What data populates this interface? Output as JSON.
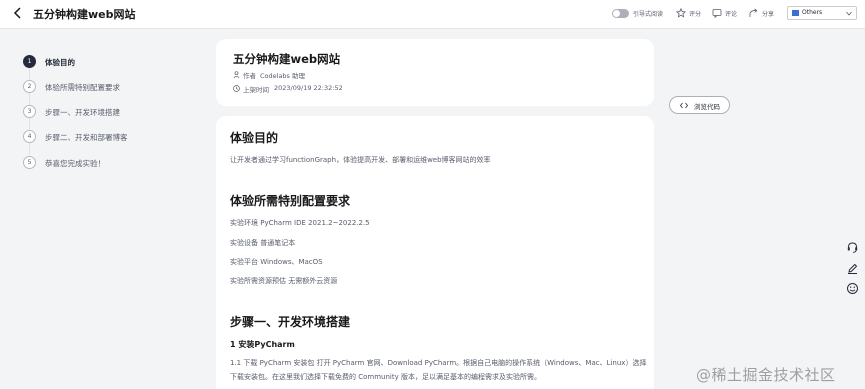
{
  "topbar": {
    "title": "五分钟构建web网站",
    "immersive_label": "引导式阅读",
    "rate_label": "评分",
    "comment_label": "评论",
    "share_label": "分享",
    "language_value": "Others"
  },
  "steps": [
    {
      "num": "1",
      "label": "体验目的",
      "active": true
    },
    {
      "num": "2",
      "label": "体验所需特别配置要求",
      "active": false
    },
    {
      "num": "3",
      "label": "步骤一、开发环境搭建",
      "active": false
    },
    {
      "num": "4",
      "label": "步骤二、开发和部署博客",
      "active": false
    },
    {
      "num": "5",
      "label": "恭喜您完成实验！",
      "active": false
    }
  ],
  "header": {
    "title": "五分钟构建web网站",
    "author_key": "作者",
    "author_value": "Codelabs 助理",
    "time_key": "上架时间",
    "time_value": "2023/09/19 22:32:52"
  },
  "view_code_label": "浏览代码",
  "content": {
    "s1_title": "体验目的",
    "s1_text": "让开发者通过学习functionGraph，体验提高开发、部署和运维web博客网站的效率",
    "s2_title": "体验所需特别配置要求",
    "s2_line1": "实验环境 PyCharm IDE 2021.2~2022.2.5",
    "s2_line2": "实验设备 普通笔记本",
    "s2_line3": "实验平台 Windows、MacOS",
    "s2_line4": "实验所需资源预估 无需额外云资源",
    "s3_title": "步骤一、开发环境搭建",
    "s3_sub": "1 安装PyCharm",
    "s3_line1": "1.1 下载 PyCharm 安装包 打开 PyCharm 官网、Download PyCharm。根据自己电脑的操作系统（Windows、Mac、Linux）选择",
    "s3_line2": "下载安装包。在这里我们选择下载免费的 Community 版本，足以满足基本的编程需求及实验所需。"
  },
  "watermark": "@稀土掘金技术社区",
  "colors": {
    "accent": "#252b3a",
    "page_bg": "#f3f4f6",
    "card_bg": "#ffffff"
  }
}
